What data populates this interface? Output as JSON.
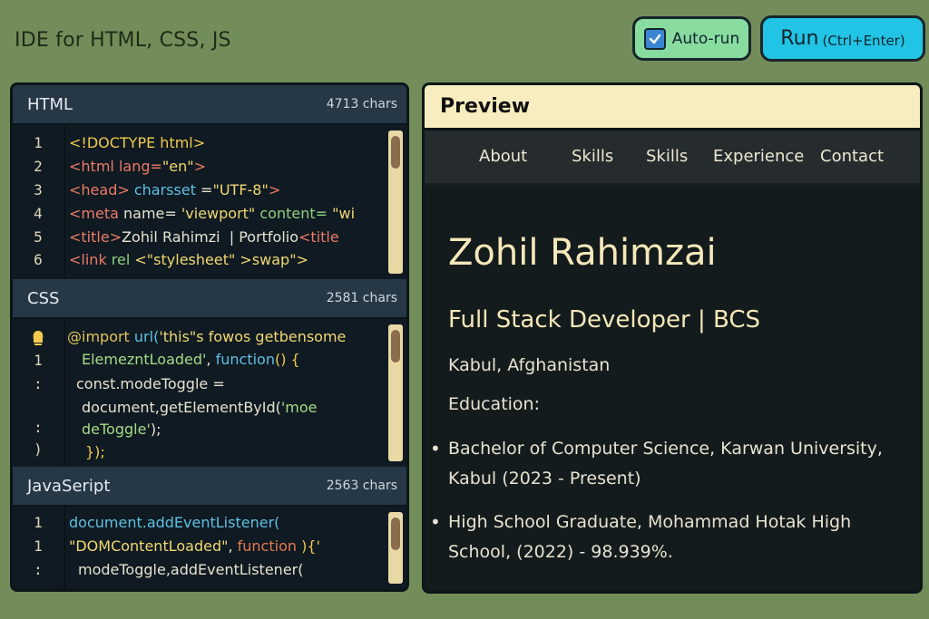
{
  "app": {
    "title": "IDE for HTML, CSS, JS"
  },
  "toolbar": {
    "autorun_label": "Auto-run",
    "autorun_checked": true,
    "run_label": "Run",
    "run_shortcut": "(Ctrl+Enter)"
  },
  "html_section": {
    "title": "HTML",
    "count": "4713 chars",
    "line_numbers": [
      "1",
      "2",
      "3",
      "4",
      "5",
      "6"
    ]
  },
  "css_section": {
    "title": "CSS",
    "count": "2581 chars",
    "line_numbers": [
      "1",
      ":",
      ":",
      ")"
    ]
  },
  "js_section": {
    "title": "JavaSeript",
    "count": "2563 chars",
    "line_numbers": [
      "1",
      "1",
      ":"
    ]
  },
  "code_text": {
    "h1": "<!DOCTYPE html>",
    "h2_tag": "<html lang=",
    "h2_val": "\"en\"",
    "h2_end": ">",
    "h3_tag": "<head>",
    "h3_attr": " charsset",
    "h3_eq": " =",
    "h3_val": "\"UTF-8\"",
    "h3_end": ">",
    "h4_tag": "<meta",
    "h4_attr": " name=",
    "h4_val": " 'viewport\"",
    "h4_attr2": " content=",
    "h4_val2": " \"wi",
    "h5_tag": "<title>",
    "h5_text": "Zohil Rahimzi  | Portfolio",
    "h5_end": "<title",
    "h6_tag": "<link",
    "h6_attr": " rel",
    "h6_val": " <\"stylesheet\"",
    "h6_end": " >swap\">",
    "c1_at": "@import",
    "c1_fn": " url(",
    "c1_str": "'this\"s fowos getbensome",
    "c2_str": "ElemezntLoaded'",
    "c2_p": ",",
    "c2_kw": " function",
    "c2_br": "() {",
    "c3": "const.modeToggle =",
    "c4_a": "document,getElementById(",
    "c4_b": "'moe",
    "c5": "deToggle'",
    "c5_end": ");",
    "c6": "});",
    "j1_fn": "document.addEventListener(",
    "j2_str": "\"DOMContentLoaded\"",
    "j2_p": ",",
    "j2_kw": " function",
    "j2_br": " ){'",
    "j3": "modeToggle,addEventListener("
  },
  "preview": {
    "title": "Preview",
    "nav": [
      "About",
      "Skills",
      "Skills",
      "Experience",
      "Contact"
    ],
    "name": "Zohil Rahimzai",
    "role": "Full Stack Developer | BCS",
    "location": "Kabul, Afghanistan",
    "education_heading": "Education:",
    "edu1_line1": "Bachelor of Computer Science, Karwan University,",
    "edu1_line2": "Kabul (2023 - Present)",
    "edu2_line1": "High School Graduate, Mohammad Hotak High",
    "edu2_line2": "School, (2022) - 98.939%."
  },
  "colors": {
    "background": "#728d59",
    "autorun_bg": "#88dca0",
    "run_bg": "#22c4e5",
    "preview_header_bg": "#f7edbf",
    "editor_bg": "#0f1a22"
  }
}
